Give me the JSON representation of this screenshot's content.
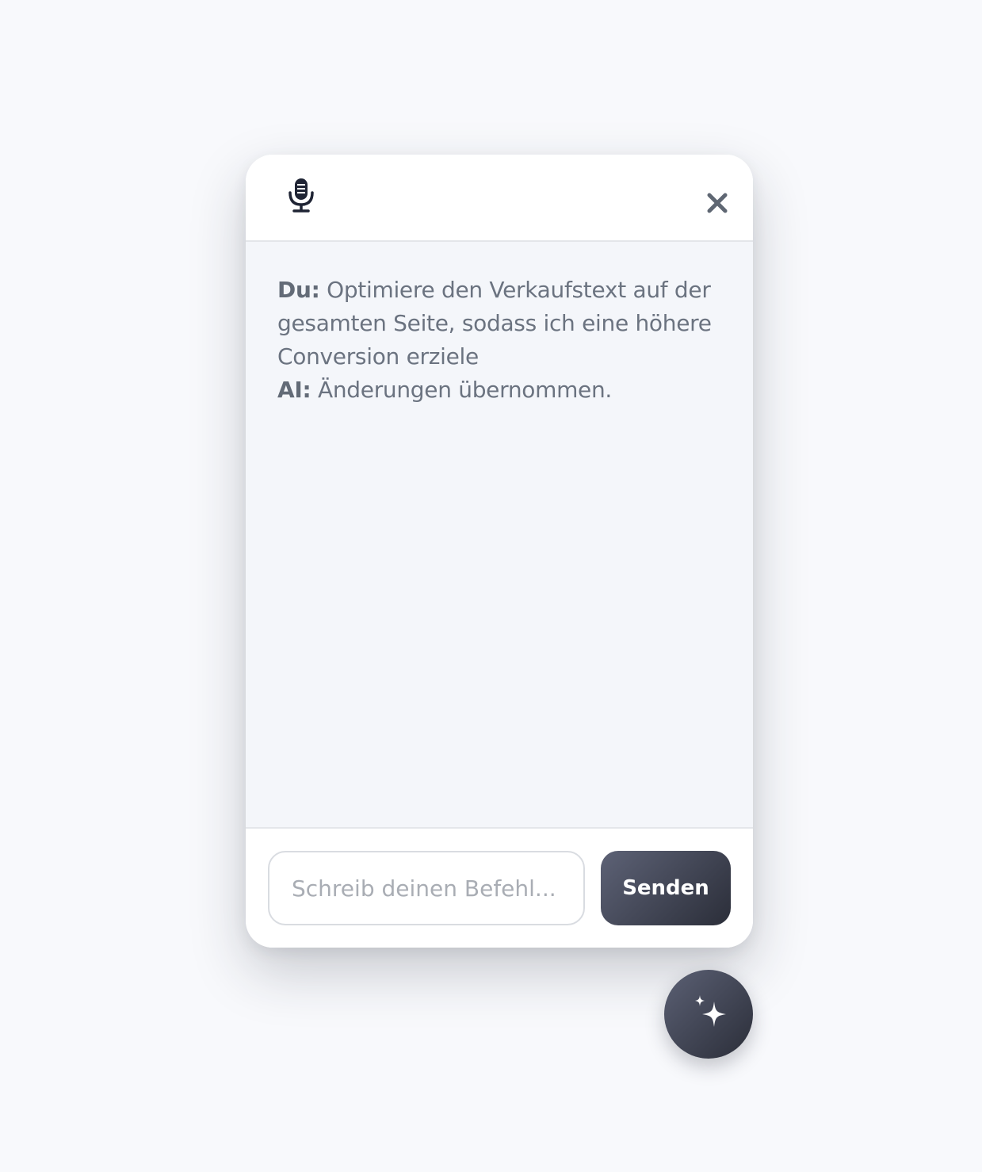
{
  "chat": {
    "messages": [
      {
        "sender": "Du:",
        "text": "Optimiere den Verkaufstext auf der gesamten Seite, sodass ich eine höhere Conversion erziele"
      },
      {
        "sender": "AI:",
        "text": "Änderungen übernommen."
      }
    ]
  },
  "composer": {
    "placeholder": "Schreib deinen Befehl...",
    "value": "",
    "send_label": "Senden"
  },
  "icons": {
    "header_left": "microphone-icon",
    "header_right": "close-icon",
    "fab": "sparkles-icon"
  },
  "colors": {
    "accent_start": "#5d6276",
    "accent_end": "#2b2e39",
    "panel_background": "#ffffff",
    "messages_background": "#f4f6fa",
    "page_background": "#f8f9fc",
    "text": "#6b7380"
  }
}
